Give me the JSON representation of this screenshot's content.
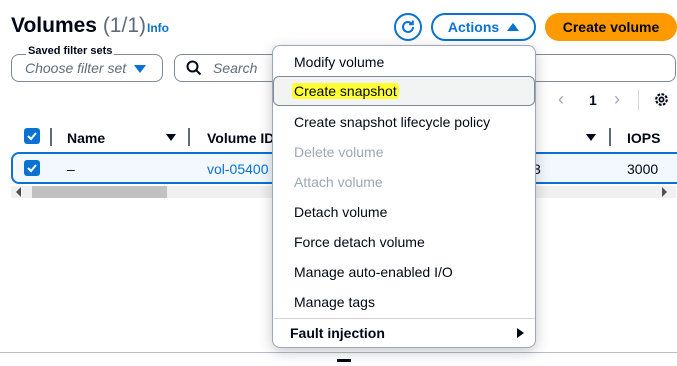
{
  "header": {
    "title": "Volumes",
    "count": "(1/1)",
    "info_label": "Info",
    "actions_label": "Actions",
    "create_label": "Create volume"
  },
  "filters": {
    "saved_sets_label": "Saved filter sets",
    "saved_sets_placeholder": "Choose filter set",
    "search_placeholder": "Search"
  },
  "pagination": {
    "prev": "‹",
    "current_page": "1",
    "next": "›"
  },
  "table": {
    "columns": [
      "Name",
      "Volume ID",
      "IOPS"
    ],
    "row": {
      "name": "–",
      "volume_id": "vol-05400",
      "size_fragment": "3",
      "iops": "3000"
    }
  },
  "actions_menu": {
    "items": [
      {
        "label": "Modify volume",
        "disabled": false
      },
      {
        "label": "Create snapshot",
        "disabled": false,
        "hovered": true,
        "highlighted": true
      },
      {
        "label": "Create snapshot lifecycle policy",
        "disabled": false
      },
      {
        "label": "Delete volume",
        "disabled": true
      },
      {
        "label": "Attach volume",
        "disabled": true
      },
      {
        "label": "Detach volume",
        "disabled": false
      },
      {
        "label": "Force detach volume",
        "disabled": false
      },
      {
        "label": "Manage auto-enabled I/O",
        "disabled": false
      },
      {
        "label": "Manage tags",
        "disabled": false
      }
    ],
    "group_label": "Fault injection"
  },
  "colors": {
    "accent": "#0972d3",
    "primary_button": "#ff9900",
    "highlight": "#ffff33",
    "disabled_text": "#9ba7b6"
  }
}
